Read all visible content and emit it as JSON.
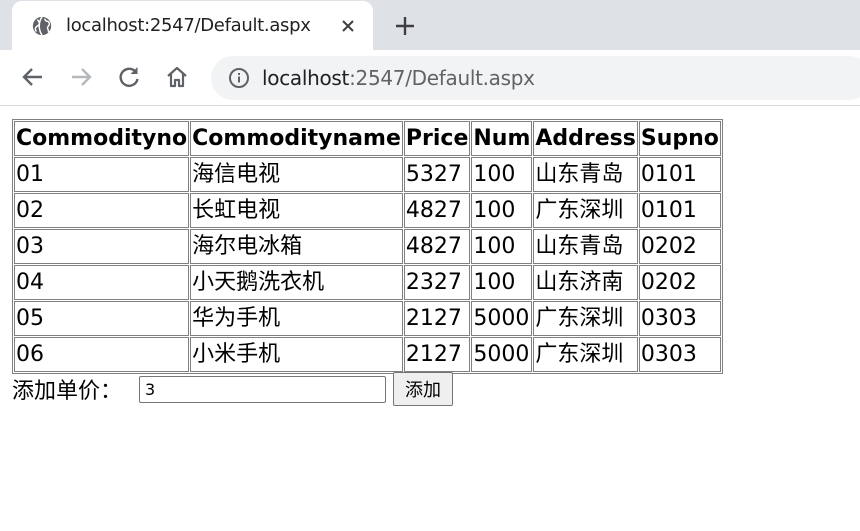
{
  "browser": {
    "tab_title": "localhost:2547/Default.aspx",
    "address_host": "localhost",
    "address_path": ":2547/Default.aspx"
  },
  "table": {
    "headers": [
      "Commodityno",
      "Commodityname",
      "Price",
      "Num",
      "Address",
      "Supno"
    ],
    "rows": [
      [
        "01",
        "海信电视",
        "5327",
        "100",
        "山东青岛",
        "0101"
      ],
      [
        "02",
        "长虹电视",
        "4827",
        "100",
        "广东深圳",
        "0101"
      ],
      [
        "03",
        "海尔电冰箱",
        "4827",
        "100",
        "山东青岛",
        "0202"
      ],
      [
        "04",
        "小天鹅洗衣机",
        "2327",
        "100",
        "山东济南",
        "0202"
      ],
      [
        "05",
        "华为手机",
        "2127",
        "5000",
        "广东深圳",
        "0303"
      ],
      [
        "06",
        "小米手机",
        "2127",
        "5000",
        "广东深圳",
        "0303"
      ]
    ]
  },
  "form": {
    "label": "添加单价：",
    "input_value": "3",
    "button_label": "添加"
  },
  "icons": {
    "favicon": "globe-icon",
    "close": "close-icon",
    "new_tab": "plus-icon",
    "back": "back-arrow-icon",
    "forward": "forward-arrow-icon",
    "reload": "reload-icon",
    "home": "home-icon",
    "site_info": "info-icon"
  },
  "colors": {
    "tabstrip": "#dee1e6",
    "omnibox": "#f1f3f4",
    "table_border": "#808080"
  }
}
